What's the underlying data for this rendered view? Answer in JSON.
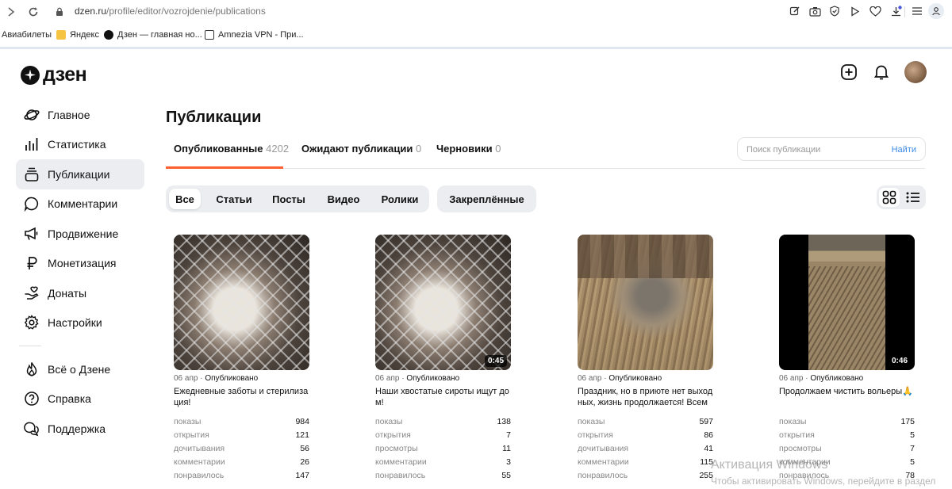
{
  "browser": {
    "url_host": "dzen.ru",
    "url_path": "/profile/editor/vozrojdenie/publications",
    "bookmarks": [
      {
        "label": "Авиабилеты",
        "icon": "none",
        "color": ""
      },
      {
        "label": "Яндекс",
        "icon": "folder-icon",
        "color": "#f5c542"
      },
      {
        "label": "Дзен — главная но...",
        "icon": "dzen-icon",
        "color": "#111111"
      },
      {
        "label": "Amnezia VPN - При...",
        "icon": "amnezia-icon",
        "color": "#333333"
      }
    ]
  },
  "app": {
    "logo_text": "дзен",
    "accent": "#ff5f2e"
  },
  "sidebar": {
    "items": [
      {
        "label": "Главное",
        "icon": "planet-icon"
      },
      {
        "label": "Статистика",
        "icon": "stats-icon"
      },
      {
        "label": "Публикации",
        "icon": "publications-icon",
        "active": true
      },
      {
        "label": "Комментарии",
        "icon": "comment-icon"
      },
      {
        "label": "Продвижение",
        "icon": "megaphone-icon"
      },
      {
        "label": "Монетизация",
        "icon": "ruble-icon"
      },
      {
        "label": "Донаты",
        "icon": "donate-icon"
      },
      {
        "label": "Настройки",
        "icon": "gear-icon"
      }
    ],
    "secondary": [
      {
        "label": "Всё о Дзене",
        "icon": "flame-icon"
      },
      {
        "label": "Справка",
        "icon": "help-icon"
      },
      {
        "label": "Поддержка",
        "icon": "support-icon"
      }
    ]
  },
  "main": {
    "title": "Публикации",
    "tabs": [
      {
        "label": "Опубликованные",
        "count": "4202"
      },
      {
        "label": "Ожидают публикации",
        "count": "0"
      },
      {
        "label": "Черновики",
        "count": "0"
      }
    ],
    "search": {
      "placeholder": "Поиск публикации",
      "button": "Найти"
    },
    "filters": [
      "Все",
      "Статьи",
      "Посты",
      "Видео",
      "Ролики"
    ],
    "pinned": "Закреплённые"
  },
  "cards": [
    {
      "date": "06 апр",
      "status": "Опубликовано",
      "title": "Ежедневные заботы и стерилизация!",
      "duration": "",
      "stats": [
        [
          "показы",
          "984"
        ],
        [
          "открытия",
          "121"
        ],
        [
          "дочитывания",
          "56"
        ],
        [
          "комментарии",
          "26"
        ],
        [
          "понравилось",
          "147"
        ]
      ]
    },
    {
      "date": "06 апр",
      "status": "Опубликовано",
      "title": "Наши хвостатые сироты ищут дом!",
      "duration": "0:45",
      "stats": [
        [
          "показы",
          "138"
        ],
        [
          "открытия",
          "7"
        ],
        [
          "просмотры",
          "11"
        ],
        [
          "комментарии",
          "3"
        ],
        [
          "понравилось",
          "55"
        ]
      ]
    },
    {
      "date": "06 апр",
      "status": "Опубликовано",
      "title": "Праздник, но в приюте нет выходных, жизнь продолжается! Всем пр...",
      "duration": "",
      "stats": [
        [
          "показы",
          "597"
        ],
        [
          "открытия",
          "86"
        ],
        [
          "дочитывания",
          "41"
        ],
        [
          "комментарии",
          "115"
        ],
        [
          "понравилось",
          "255"
        ]
      ]
    },
    {
      "date": "06 апр",
      "status": "Опубликовано",
      "title": "Продолжаем чистить вольеры🙏",
      "duration": "0:46",
      "stats": [
        [
          "показы",
          "175"
        ],
        [
          "открытия",
          "5"
        ],
        [
          "просмотры",
          "7"
        ],
        [
          "комментарии",
          "5"
        ],
        [
          "понравилось",
          "78"
        ]
      ]
    }
  ],
  "watermark": {
    "line1": "Активация Windows",
    "line2": "Чтобы активировать Windows, перейдите в раздел"
  }
}
